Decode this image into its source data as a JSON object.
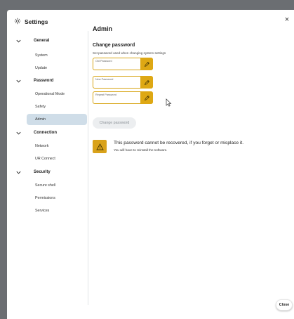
{
  "window": {
    "title": "Settings",
    "close_glyph": "×"
  },
  "sidebar": {
    "groups": [
      {
        "label": "General",
        "items": [
          "System",
          "Update"
        ]
      },
      {
        "label": "Password",
        "items": [
          "Operational Mode",
          "Safety",
          "Admin"
        ]
      },
      {
        "label": "Connection",
        "items": [
          "Network",
          "UR Connect"
        ]
      },
      {
        "label": "Security",
        "items": [
          "Secure shell",
          "Permissions",
          "Services"
        ]
      }
    ],
    "active_item": "Admin"
  },
  "main": {
    "title": "Admin",
    "section_title": "Change password",
    "section_desc": "Set password used when changing system settings",
    "fields": {
      "old_password": {
        "label": "Old Password",
        "value": ""
      },
      "new_password": {
        "label": "New Password",
        "value": ""
      },
      "repeat_password": {
        "label": "Repeat Password",
        "value": ""
      }
    },
    "change_button": "Change password",
    "warning": {
      "main": "This password cannot be recovered, if you forget or misplace it.",
      "sub": "You will have to reinstall the software."
    }
  },
  "footer": {
    "close_label": "Close"
  },
  "colors": {
    "accent": "#dea814",
    "active_nav": "#cfdde8",
    "disabled_btn": "#eceef0"
  },
  "icons": {
    "title": "gear-icon",
    "field_edit": "pencil-icon",
    "warning": "warning-triangle-icon",
    "group": "chevron-down-icon"
  }
}
